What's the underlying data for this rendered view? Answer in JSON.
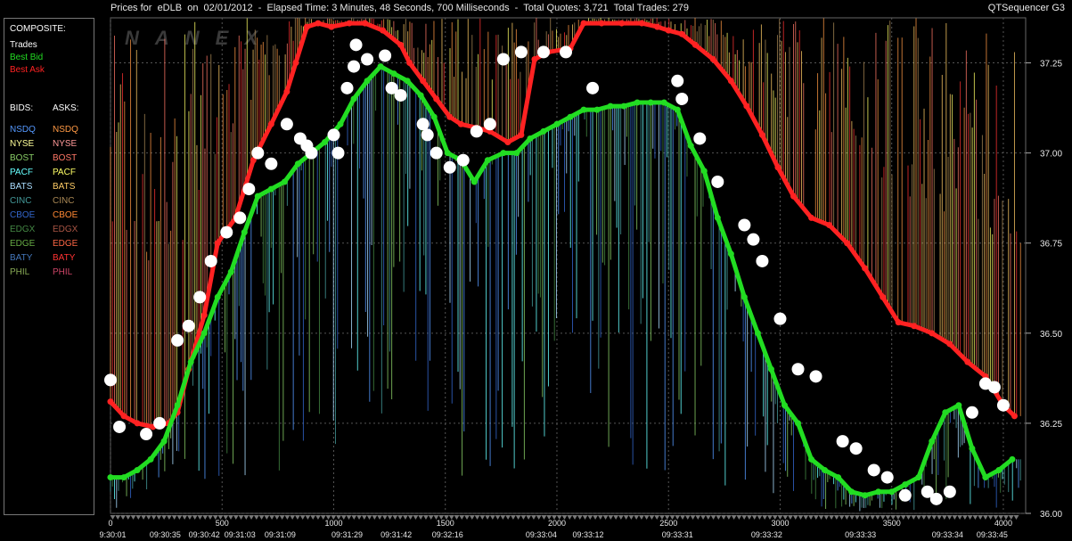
{
  "window": {
    "title": "Prices for  eDLB  on  02/01/2012  -  Elapsed Time: 3 Minutes, 48 Seconds, 700 Milliseconds  -  Total Quotes: 3,721  Total Trades: 279",
    "app_name": "QTSequencer G3",
    "watermark": "NANEX"
  },
  "legend": {
    "composite_header": "COMPOSITE:",
    "composite_items": [
      {
        "label": "Trades",
        "color": "#ffffff"
      },
      {
        "label": "Best Bid",
        "color": "#22dd22"
      },
      {
        "label": "Best Ask",
        "color": "#ff2222"
      }
    ],
    "bids_header": "BIDS:",
    "asks_header": "ASKS:",
    "exchanges": [
      {
        "bid": "NSDQ",
        "ask": "NSDQ",
        "bid_color": "#5599ff",
        "ask_color": "#ff9944"
      },
      {
        "bid": "NYSE",
        "ask": "NYSE",
        "bid_color": "#ffff99",
        "ask_color": "#ff9999"
      },
      {
        "bid": "BOST",
        "ask": "BOST",
        "bid_color": "#88cc66",
        "ask_color": "#ff7766"
      },
      {
        "bid": "PACF",
        "ask": "PACF",
        "bid_color": "#66ffff",
        "ask_color": "#ffff66"
      },
      {
        "bid": "BATS",
        "ask": "BATS",
        "bid_color": "#aaddff",
        "ask_color": "#ffcc66"
      },
      {
        "bid": "CINC",
        "ask": "CINC",
        "bid_color": "#449999",
        "ask_color": "#aa8855"
      },
      {
        "bid": "CBOE",
        "ask": "CBOE",
        "bid_color": "#3366cc",
        "ask_color": "#ff8833"
      },
      {
        "bid": "EDGX",
        "ask": "EDGX",
        "bid_color": "#448844",
        "ask_color": "#aa5544"
      },
      {
        "bid": "EDGE",
        "ask": "EDGE",
        "bid_color": "#66aa44",
        "ask_color": "#ff6644"
      },
      {
        "bid": "BATY",
        "ask": "BATY",
        "bid_color": "#4477bb",
        "ask_color": "#ff3333"
      },
      {
        "bid": "PHIL",
        "ask": "PHIL",
        "bid_color": "#88aa55",
        "ask_color": "#cc4466"
      }
    ]
  },
  "chart_data": {
    "type": "line",
    "ylim": [
      36.0,
      37.375
    ],
    "xlim": [
      0,
      4100
    ],
    "y_ticks": [
      36.0,
      36.25,
      36.5,
      36.75,
      37.0,
      37.25
    ],
    "y_tick_labels": [
      "36.00",
      "36.25",
      "36.50",
      "36.75",
      "37.00",
      "37.25"
    ],
    "x_ticks": [
      0,
      500,
      1000,
      1500,
      2000,
      2500,
      3000,
      3500,
      4000
    ],
    "x_tick_labels": [
      "0",
      "500",
      "1000",
      "1500",
      "2000",
      "2500",
      "3000",
      "3500",
      "4000"
    ],
    "time_labels": [
      "9:30:01",
      "09:30:35",
      "09:30:42",
      "09:31:03",
      "09:31:09",
      "09:31:29",
      "09:31:42",
      "09:32:16",
      "09:33:04",
      "09:33:12",
      "09:33:31",
      "09:33:32",
      "09:33:33",
      "09:33:34",
      "09:33:45"
    ],
    "time_label_x": [
      10,
      245,
      420,
      580,
      760,
      1060,
      1280,
      1510,
      1930,
      2140,
      2540,
      2940,
      3360,
      3750,
      3950
    ],
    "grid": true,
    "series": [
      {
        "name": "Best Ask",
        "color": "#ff2222",
        "x": [
          0,
          60,
          120,
          190,
          260,
          300,
          350,
          420,
          480,
          560,
          640,
          720,
          790,
          830,
          880,
          930,
          990,
          1070,
          1140,
          1220,
          1300,
          1340,
          1400,
          1460,
          1520,
          1570,
          1640,
          1700,
          1780,
          1840,
          1900,
          1960,
          2060,
          2120,
          2200,
          2290,
          2380,
          2450,
          2500,
          2560,
          2620,
          2700,
          2780,
          2850,
          2920,
          2990,
          3060,
          3140,
          3220,
          3300,
          3380,
          3460,
          3530,
          3600,
          3680,
          3760,
          3840,
          3920,
          4000,
          4050
        ],
        "y": [
          36.31,
          36.27,
          36.25,
          36.24,
          36.25,
          36.28,
          36.4,
          36.55,
          36.75,
          36.82,
          36.98,
          37.08,
          37.17,
          37.25,
          37.35,
          37.36,
          37.35,
          37.36,
          37.36,
          37.34,
          37.3,
          37.25,
          37.2,
          37.15,
          37.1,
          37.08,
          37.07,
          37.06,
          37.03,
          37.05,
          37.26,
          37.28,
          37.29,
          37.36,
          37.36,
          37.36,
          37.36,
          37.35,
          37.34,
          37.33,
          37.3,
          37.26,
          37.2,
          37.13,
          37.05,
          36.96,
          36.88,
          36.82,
          36.8,
          36.75,
          36.68,
          36.6,
          36.53,
          36.52,
          36.5,
          36.47,
          36.42,
          36.38,
          36.3,
          36.27
        ]
      },
      {
        "name": "Best Bid",
        "color": "#22dd22",
        "x": [
          0,
          60,
          120,
          180,
          240,
          300,
          360,
          420,
          480,
          540,
          600,
          660,
          720,
          780,
          840,
          900,
          960,
          1030,
          1090,
          1150,
          1210,
          1270,
          1330,
          1390,
          1450,
          1510,
          1570,
          1630,
          1690,
          1760,
          1820,
          1880,
          1940,
          2000,
          2060,
          2120,
          2180,
          2240,
          2300,
          2360,
          2420,
          2480,
          2540,
          2600,
          2660,
          2720,
          2780,
          2840,
          2900,
          2960,
          3020,
          3080,
          3140,
          3200,
          3260,
          3320,
          3380,
          3440,
          3500,
          3560,
          3620,
          3680,
          3740,
          3800,
          3860,
          3920,
          3980,
          4040
        ],
        "y": [
          36.1,
          36.1,
          36.12,
          36.15,
          36.2,
          36.3,
          36.42,
          36.5,
          36.6,
          36.67,
          36.78,
          36.88,
          36.9,
          36.92,
          36.97,
          37.0,
          37.03,
          37.08,
          37.15,
          37.2,
          37.24,
          37.22,
          37.2,
          37.16,
          37.1,
          37.0,
          36.98,
          36.92,
          36.98,
          37.0,
          37.0,
          37.04,
          37.06,
          37.08,
          37.1,
          37.12,
          37.12,
          37.13,
          37.13,
          37.14,
          37.14,
          37.14,
          37.12,
          37.02,
          36.95,
          36.82,
          36.72,
          36.6,
          36.5,
          36.4,
          36.3,
          36.25,
          36.15,
          36.12,
          36.1,
          36.06,
          36.05,
          36.06,
          36.06,
          36.08,
          36.1,
          36.2,
          36.28,
          36.3,
          36.18,
          36.1,
          36.12,
          36.15
        ]
      },
      {
        "name": "Trades",
        "color": "#ffffff",
        "x": [
          0,
          40,
          160,
          220,
          300,
          350,
          400,
          450,
          520,
          580,
          620,
          660,
          720,
          790,
          850,
          880,
          900,
          1000,
          1020,
          1060,
          1090,
          1100,
          1150,
          1230,
          1260,
          1300,
          1400,
          1420,
          1460,
          1520,
          1580,
          1640,
          1700,
          1760,
          1840,
          1940,
          2040,
          2160,
          2540,
          2560,
          2640,
          2720,
          2840,
          2880,
          2920,
          3000,
          3080,
          3160,
          3280,
          3340,
          3420,
          3480,
          3560,
          3660,
          3700,
          3760,
          3860,
          3920,
          3960,
          4000
        ],
        "y": [
          36.37,
          36.24,
          36.22,
          36.25,
          36.48,
          36.52,
          36.6,
          36.7,
          36.78,
          36.82,
          36.9,
          37.0,
          36.97,
          37.08,
          37.04,
          37.02,
          37.0,
          37.05,
          37.0,
          37.18,
          37.24,
          37.3,
          37.26,
          37.27,
          37.18,
          37.16,
          37.08,
          37.05,
          37.0,
          36.96,
          36.98,
          37.06,
          37.08,
          37.26,
          37.28,
          37.28,
          37.28,
          37.18,
          37.2,
          37.15,
          37.04,
          36.92,
          36.8,
          36.76,
          36.7,
          36.54,
          36.4,
          36.38,
          36.2,
          36.18,
          36.12,
          36.1,
          36.05,
          36.06,
          36.04,
          36.06,
          36.28,
          36.36,
          36.35,
          36.3
        ]
      }
    ]
  }
}
